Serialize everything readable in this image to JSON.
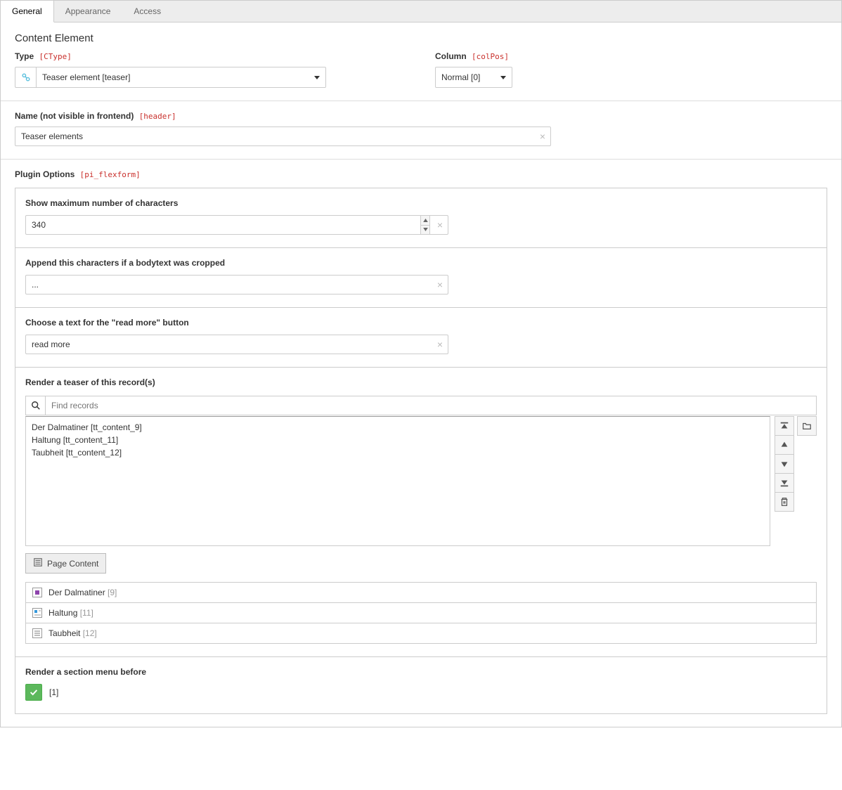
{
  "tabs": {
    "general": "General",
    "appearance": "Appearance",
    "access": "Access"
  },
  "contentElement": {
    "title": "Content Element",
    "typeLabel": "Type",
    "typeTech": "[CType]",
    "typeValue": "Teaser element [teaser]",
    "columnLabel": "Column",
    "columnTech": "[colPos]",
    "columnValue": "Normal [0]"
  },
  "nameField": {
    "label": "Name (not visible in frontend)",
    "tech": "[header]",
    "value": "Teaser elements"
  },
  "pluginOptions": {
    "label": "Plugin Options",
    "tech": "[pi_flexform]",
    "maxChars": {
      "label": "Show maximum number of characters",
      "value": "340"
    },
    "appendChars": {
      "label": "Append this characters if a bodytext was cropped",
      "value": "..."
    },
    "readMore": {
      "label": "Choose a text for the \"read more\" button",
      "value": "read more"
    },
    "records": {
      "label": "Render a teaser of this record(s)",
      "searchPlaceholder": "Find records",
      "items": [
        "Der Dalmatiner [tt_content_9]",
        "Haltung [tt_content_11]",
        "Taubheit [tt_content_12]"
      ],
      "pageContentBtn": "Page Content",
      "links": [
        {
          "title": "Der Dalmatiner",
          "id": "[9]"
        },
        {
          "title": "Haltung",
          "id": "[11]"
        },
        {
          "title": "Taubheit",
          "id": "[12]"
        }
      ]
    },
    "sectionMenu": {
      "label": "Render a section menu before",
      "valueLabel": "[1]"
    }
  }
}
